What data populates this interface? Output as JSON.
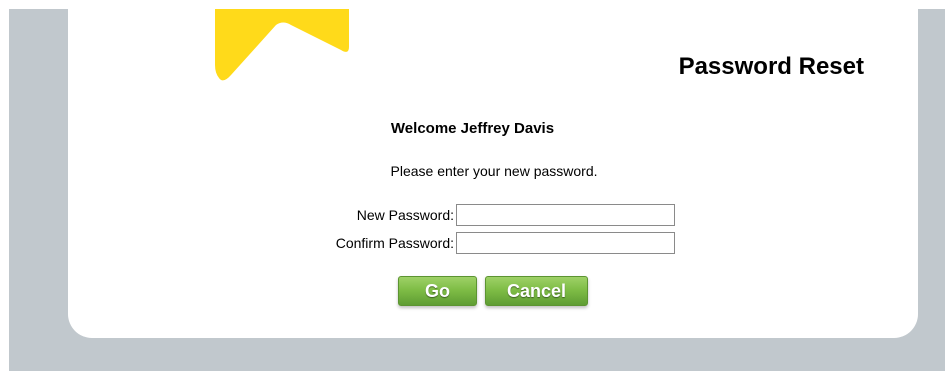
{
  "page": {
    "title": "Password Reset",
    "welcome": "Welcome Jeffrey Davis",
    "instructions": "Please enter your new password."
  },
  "logo": {
    "icon": "chevron-up-logo",
    "color": "#ffda1a"
  },
  "form": {
    "new_password": {
      "label": "New Password:",
      "value": "",
      "placeholder": ""
    },
    "confirm_password": {
      "label": "Confirm Password:",
      "value": "",
      "placeholder": ""
    }
  },
  "buttons": {
    "go_label": "Go",
    "cancel_label": "Cancel"
  },
  "colors": {
    "backdrop": "#c1c8cd",
    "card": "#ffffff",
    "button_green": "#7fbd46",
    "logo_yellow": "#ffda1a"
  }
}
